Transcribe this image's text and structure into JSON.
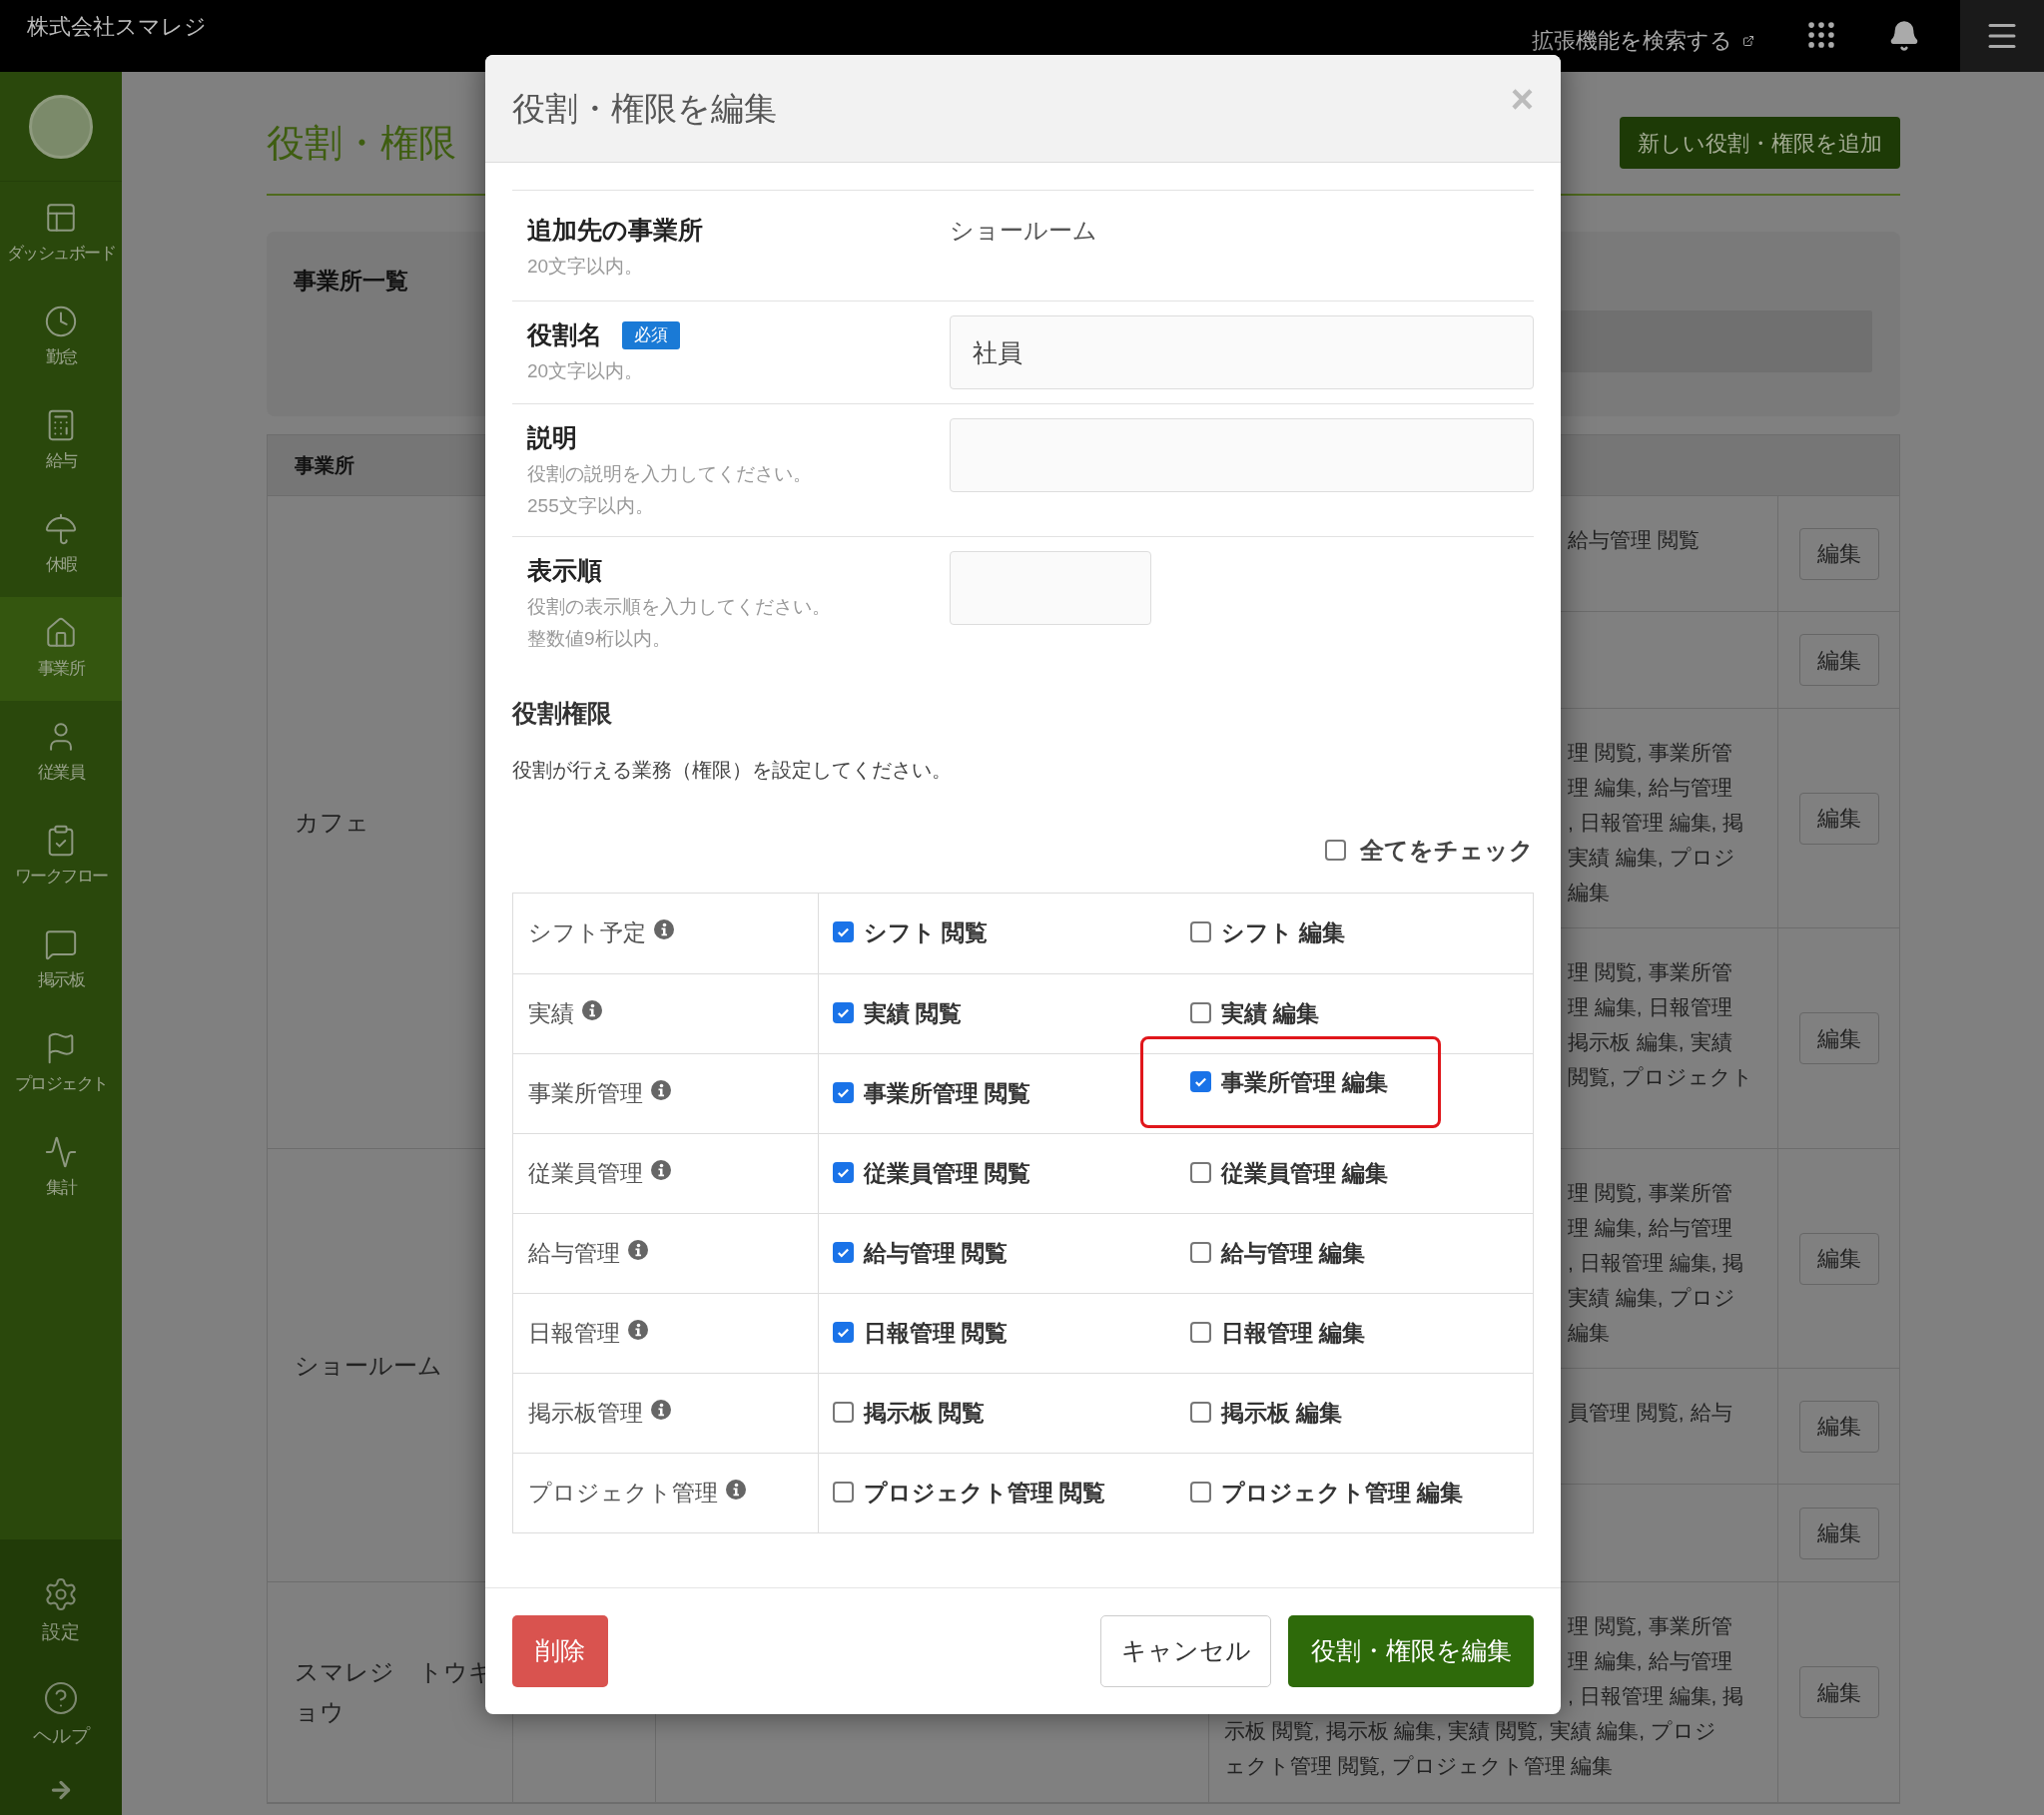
{
  "company": "株式会社スマレジ",
  "header": {
    "extension_link": "拡張機能を検索する"
  },
  "sidebar": {
    "items": [
      {
        "label": "ダッシュボード",
        "selected": false
      },
      {
        "label": "勤怠",
        "selected": false
      },
      {
        "label": "給与",
        "selected": false
      },
      {
        "label": "休暇",
        "selected": false
      },
      {
        "label": "事業所",
        "selected": true
      },
      {
        "label": "従業員",
        "selected": false
      },
      {
        "label": "ワークフロー",
        "selected": false
      },
      {
        "label": "掲示板",
        "selected": false
      },
      {
        "label": "プロジェクト",
        "selected": false
      },
      {
        "label": "集計",
        "selected": false
      }
    ],
    "bottom_items": [
      {
        "label": "設定"
      },
      {
        "label": "ヘルプ"
      }
    ]
  },
  "page": {
    "title": "役割・権限",
    "add_button": "新しい役割・権限を追加",
    "filter_card": {
      "title": "事業所一覧"
    },
    "table": {
      "columns": [
        "事業所"
      ],
      "groups": [
        {
          "location": "カフェ",
          "rows": [
            {
              "permissions": [
                {
                  "text": "給与管理 閲覧",
                  "kind": "partial"
                }
              ],
              "action": "編集"
            },
            {
              "action": "編集"
            },
            {
              "permissions": [
                {
                  "text": "理 閲覧, 事業所管",
                  "kind": "partial"
                },
                {
                  "text": "理 編集, 給与管理",
                  "kind": "partial"
                },
                {
                  "text": ", 日報管理 編集, 掲",
                  "kind": "partial"
                },
                {
                  "text": "実績 編集, プロジ",
                  "kind": "partial"
                },
                {
                  "text": "編集",
                  "kind": "partial"
                }
              ],
              "action": "編集"
            },
            {
              "permissions": [
                {
                  "text": "理 閲覧, 事業所管",
                  "kind": "partial"
                },
                {
                  "text": "理 編集, 日報管理",
                  "kind": "partial"
                },
                {
                  "text": "掲示板 編集, 実績",
                  "kind": "partial"
                },
                {
                  "text": "閲覧, プロジェクト",
                  "kind": "partial"
                }
              ],
              "action": "編集"
            }
          ]
        },
        {
          "location": "ショールーム",
          "rows": [
            {
              "permissions": [
                {
                  "text": "理 閲覧, 事業所管",
                  "kind": "partial"
                },
                {
                  "text": "理 編集, 給与管理",
                  "kind": "partial"
                },
                {
                  "text": ", 日報管理 編集, 掲",
                  "kind": "partial"
                },
                {
                  "text": "実績 編集, プロジ",
                  "kind": "partial"
                },
                {
                  "text": "編集",
                  "kind": "partial"
                }
              ],
              "action": "編集"
            },
            {
              "permissions": [
                {
                  "text": "員管理 閲覧, 給与",
                  "kind": "partial"
                }
              ],
              "action": "編集"
            },
            {
              "action": "編集"
            }
          ]
        },
        {
          "location": "スマレジ　トウキョウ",
          "rows": [
            {
              "permissions": [
                {
                  "text": "理 閲覧, 事業所管",
                  "kind": "partial"
                },
                {
                  "text": "理 編集, 給与管理",
                  "kind": "partial"
                },
                {
                  "text": ", 日報管理 編集, 掲",
                  "kind": "partial"
                },
                {
                  "text": "示板 閲覧, 掲示板 編集, 実績 閲覧, 実績 編集, プロジ",
                  "kind": "full"
                },
                {
                  "text": "ェクト管理 閲覧, プロジェクト管理 編集",
                  "kind": "full"
                }
              ],
              "action": "編集"
            }
          ]
        }
      ]
    }
  },
  "modal": {
    "title": "役割・権限を編集",
    "close": "×",
    "fields": [
      {
        "label": "追加先の事業所",
        "hints": [
          "20文字以内。"
        ],
        "kind": "static",
        "value": "ショールーム"
      },
      {
        "label": "役割名",
        "badge": "必須",
        "hints": [
          "20文字以内。"
        ],
        "kind": "input",
        "value": "社員"
      },
      {
        "label": "説明",
        "hints": [
          "役割の説明を入力してください。",
          "255文字以内。"
        ],
        "kind": "input"
      },
      {
        "label": "表示順",
        "hints": [
          "役割の表示順を入力してください。",
          "整数値9桁以内。"
        ],
        "kind": "short_input"
      }
    ],
    "permissions": {
      "title": "役割権限",
      "description": "役割が行える業務（権限）を設定してください。",
      "check_all": {
        "label": "全てをチェック",
        "checked": false
      },
      "rows": [
        {
          "name": "シフト予定",
          "view": {
            "label": "シフト 閲覧",
            "checked": true,
            "highlighted": false
          },
          "edit": {
            "label": "シフト 編集",
            "checked": false,
            "highlighted": false
          }
        },
        {
          "name": "実績",
          "view": {
            "label": "実績 閲覧",
            "checked": true,
            "highlighted": false
          },
          "edit": {
            "label": "実績 編集",
            "checked": false,
            "highlighted": false
          }
        },
        {
          "name": "事業所管理",
          "view": {
            "label": "事業所管理 閲覧",
            "checked": true,
            "highlighted": false
          },
          "edit": {
            "label": "事業所管理 編集",
            "checked": true,
            "highlighted": true
          }
        },
        {
          "name": "従業員管理",
          "view": {
            "label": "従業員管理 閲覧",
            "checked": true,
            "highlighted": false
          },
          "edit": {
            "label": "従業員管理 編集",
            "checked": false,
            "highlighted": false
          }
        },
        {
          "name": "給与管理",
          "view": {
            "label": "給与管理 閲覧",
            "checked": true,
            "highlighted": false
          },
          "edit": {
            "label": "給与管理 編集",
            "checked": false,
            "highlighted": false
          }
        },
        {
          "name": "日報管理",
          "view": {
            "label": "日報管理 閲覧",
            "checked": true,
            "highlighted": false
          },
          "edit": {
            "label": "日報管理 編集",
            "checked": false,
            "highlighted": false
          }
        },
        {
          "name": "掲示板管理",
          "view": {
            "label": "掲示板 閲覧",
            "checked": false,
            "highlighted": false
          },
          "edit": {
            "label": "掲示板 編集",
            "checked": false,
            "highlighted": false
          }
        },
        {
          "name": "プロジェクト管理",
          "view": {
            "label": "プロジェクト管理 閲覧",
            "checked": false,
            "highlighted": false
          },
          "edit": {
            "label": "プロジェクト管理 編集",
            "checked": false,
            "highlighted": false
          }
        }
      ]
    },
    "delete_button": "削除",
    "cancel_button": "キャンセル",
    "submit_button": "役割・権限を編集"
  }
}
